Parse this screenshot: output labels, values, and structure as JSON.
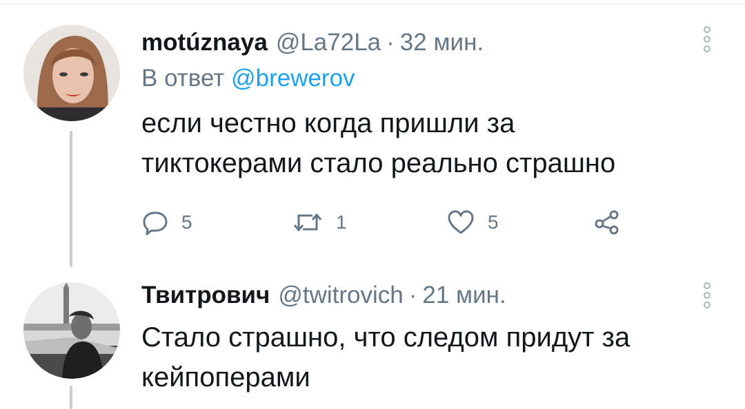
{
  "tweets": [
    {
      "display_name": "motúznaya",
      "handle": "@La72La",
      "separator": "·",
      "time": "32 мин.",
      "reply_prefix": "В ответ",
      "reply_to": "@brewerov",
      "text_lines": [
        "если честно когда пришли за",
        "тиктокерами стало реально страшно"
      ],
      "actions": {
        "replies": "5",
        "retweets": "1",
        "likes": "5"
      }
    },
    {
      "display_name": "Твитрович",
      "handle": "@twitrovich",
      "separator": "·",
      "time": "21 мин.",
      "text_lines": [
        "Стало страшно, что следом придут за",
        "кейпоперами"
      ]
    }
  ],
  "colors": {
    "text_primary": "#14171a",
    "text_secondary": "#657786",
    "link": "#1da1f2",
    "thread_line": "#c4cfd6"
  }
}
